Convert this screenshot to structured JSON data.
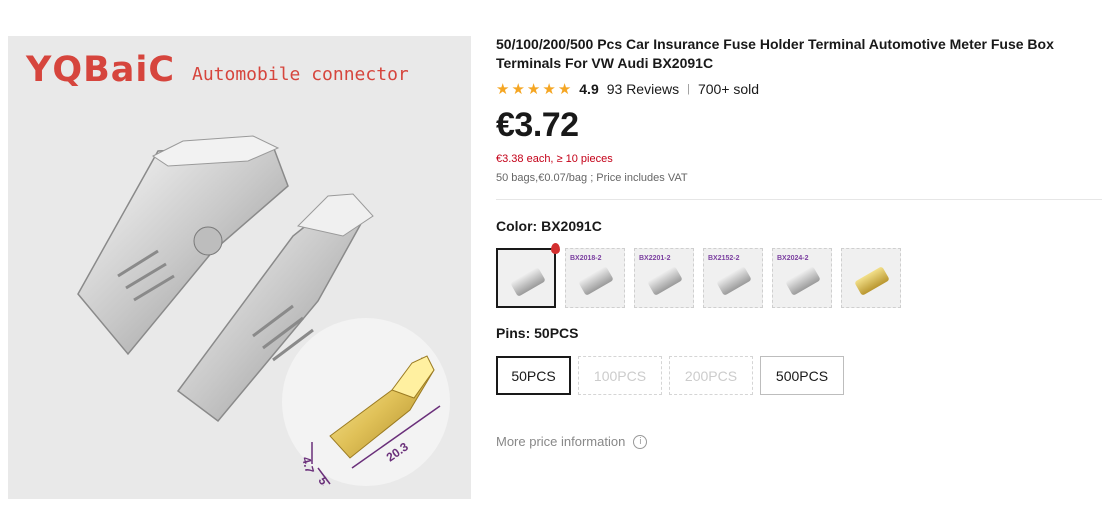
{
  "gallery": {
    "brand": "YQBaiC",
    "brand_sub": "Automobile connector",
    "dimensions": [
      "4.7",
      "5.0",
      "20.3"
    ]
  },
  "product": {
    "title": "50/100/200/500 Pcs Car Insurance Fuse Holder Terminal Automotive Meter Fuse Box Terminals For VW Audi BX2091C",
    "rating": "4.9",
    "stars": 5,
    "reviews": "93 Reviews",
    "separator": "|",
    "sold": "700+ sold",
    "price": "€3.72",
    "bulk_price": "€3.38 each, ≥ 10 pieces",
    "unit_info": "50 bags,€0.07/bag ; Price includes VAT"
  },
  "color": {
    "label": "Color: BX2091C",
    "swatches": [
      {
        "code": "",
        "finish": "silver",
        "selected": true
      },
      {
        "code": "BX2018-2",
        "finish": "silver",
        "selected": false
      },
      {
        "code": "BX2201-2",
        "finish": "silver",
        "selected": false
      },
      {
        "code": "BX2152-2",
        "finish": "silver",
        "selected": false
      },
      {
        "code": "BX2024-2",
        "finish": "silver",
        "selected": false
      },
      {
        "code": "",
        "finish": "gold",
        "selected": false
      }
    ]
  },
  "pins": {
    "label": "Pins: 50PCS",
    "options": [
      {
        "label": "50PCS",
        "state": "selected"
      },
      {
        "label": "100PCS",
        "state": "disabled"
      },
      {
        "label": "200PCS",
        "state": "disabled"
      },
      {
        "label": "500PCS",
        "state": "available"
      }
    ]
  },
  "more_info": {
    "label": "More price information",
    "icon": "info-icon"
  },
  "colors": {
    "brand": "#d6453d",
    "bulk_price": "#c40018",
    "star": "#f5a623",
    "dimension": "#6a2f7a"
  }
}
